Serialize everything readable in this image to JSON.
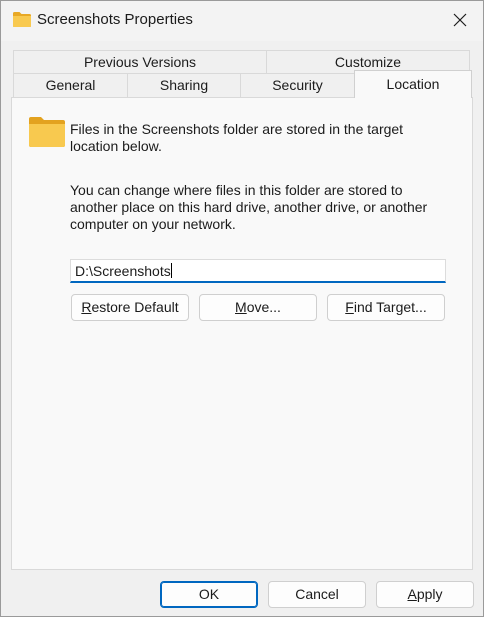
{
  "window": {
    "title": "Screenshots Properties",
    "icon": "folder-icon",
    "close_icon": "close-icon"
  },
  "tabs": {
    "row1": [
      {
        "label": "Previous Versions"
      },
      {
        "label": "Customize"
      }
    ],
    "row2": [
      {
        "label": "General"
      },
      {
        "label": "Sharing"
      },
      {
        "label": "Security"
      },
      {
        "label": "Location",
        "active": true
      }
    ]
  },
  "location": {
    "info": "Files in the Screenshots folder are stored in the target location below.",
    "description": "You can change where files in this folder are stored to another place on this hard drive, another drive, or another computer on your network.",
    "path": "D:\\Screenshots",
    "buttons": {
      "restore_rest": "estore Default",
      "restore_key": "R",
      "move_key": "M",
      "move_rest": "ove...",
      "find_key": "F",
      "find_rest": "ind Target..."
    }
  },
  "footer": {
    "ok": "OK",
    "cancel": "Cancel",
    "apply_key": "A",
    "apply_rest": "pply"
  },
  "colors": {
    "accent": "#0067c0",
    "folder": "#f4c04e"
  }
}
